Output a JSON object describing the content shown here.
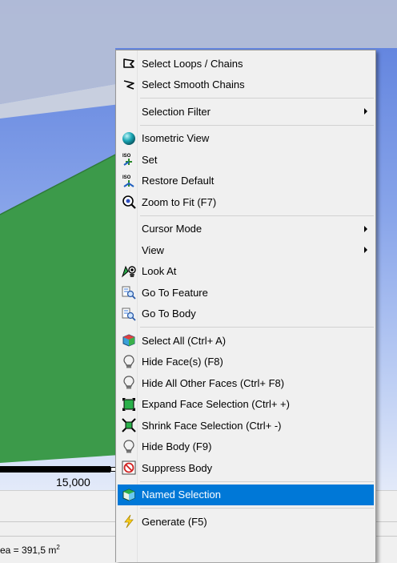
{
  "viewport": {
    "scale_label": "15,000"
  },
  "status": {
    "area_text": "ea = 391,5 m",
    "area_unit_exp": "2"
  },
  "menu": {
    "items": [
      {
        "label": "Select Loops / Chains",
        "icon": "loop-chain-icon"
      },
      {
        "label": "Select Smooth Chains",
        "icon": "smooth-chain-icon"
      },
      {
        "label": "Selection Filter",
        "submenu": true
      },
      {
        "label": "Isometric View",
        "icon": "sphere-icon"
      },
      {
        "label": "Set",
        "icon": "iso-set-icon"
      },
      {
        "label": "Restore Default",
        "icon": "iso-restore-icon"
      },
      {
        "label": "Zoom to Fit (F7)",
        "icon": "zoom-fit-icon"
      },
      {
        "label": "Cursor Mode",
        "submenu": true
      },
      {
        "label": "View",
        "submenu": true
      },
      {
        "label": "Look At",
        "icon": "look-at-icon"
      },
      {
        "label": "Go To Feature",
        "icon": "go-to-feature-icon"
      },
      {
        "label": "Go To Body",
        "icon": "go-to-body-icon"
      },
      {
        "label": "Select All (Ctrl+ A)",
        "icon": "select-all-icon"
      },
      {
        "label": "Hide Face(s) (F8)",
        "icon": "bulb-icon"
      },
      {
        "label": "Hide All Other Faces (Ctrl+ F8)",
        "icon": "bulb-icon"
      },
      {
        "label": "Expand Face Selection (Ctrl+ +)",
        "icon": "expand-selection-icon"
      },
      {
        "label": "Shrink Face Selection (Ctrl+ -)",
        "icon": "shrink-selection-icon"
      },
      {
        "label": "Hide Body (F9)",
        "icon": "bulb-icon"
      },
      {
        "label": "Suppress Body",
        "icon": "suppress-body-icon"
      },
      {
        "label": "Named Selection",
        "icon": "named-selection-icon"
      },
      {
        "label": "Generate (F5)",
        "icon": "lightning-icon"
      }
    ]
  },
  "colors": {
    "menu_background": "#f0f0f0",
    "highlight": "#0078d7",
    "model_face": "#3c9a4a"
  }
}
